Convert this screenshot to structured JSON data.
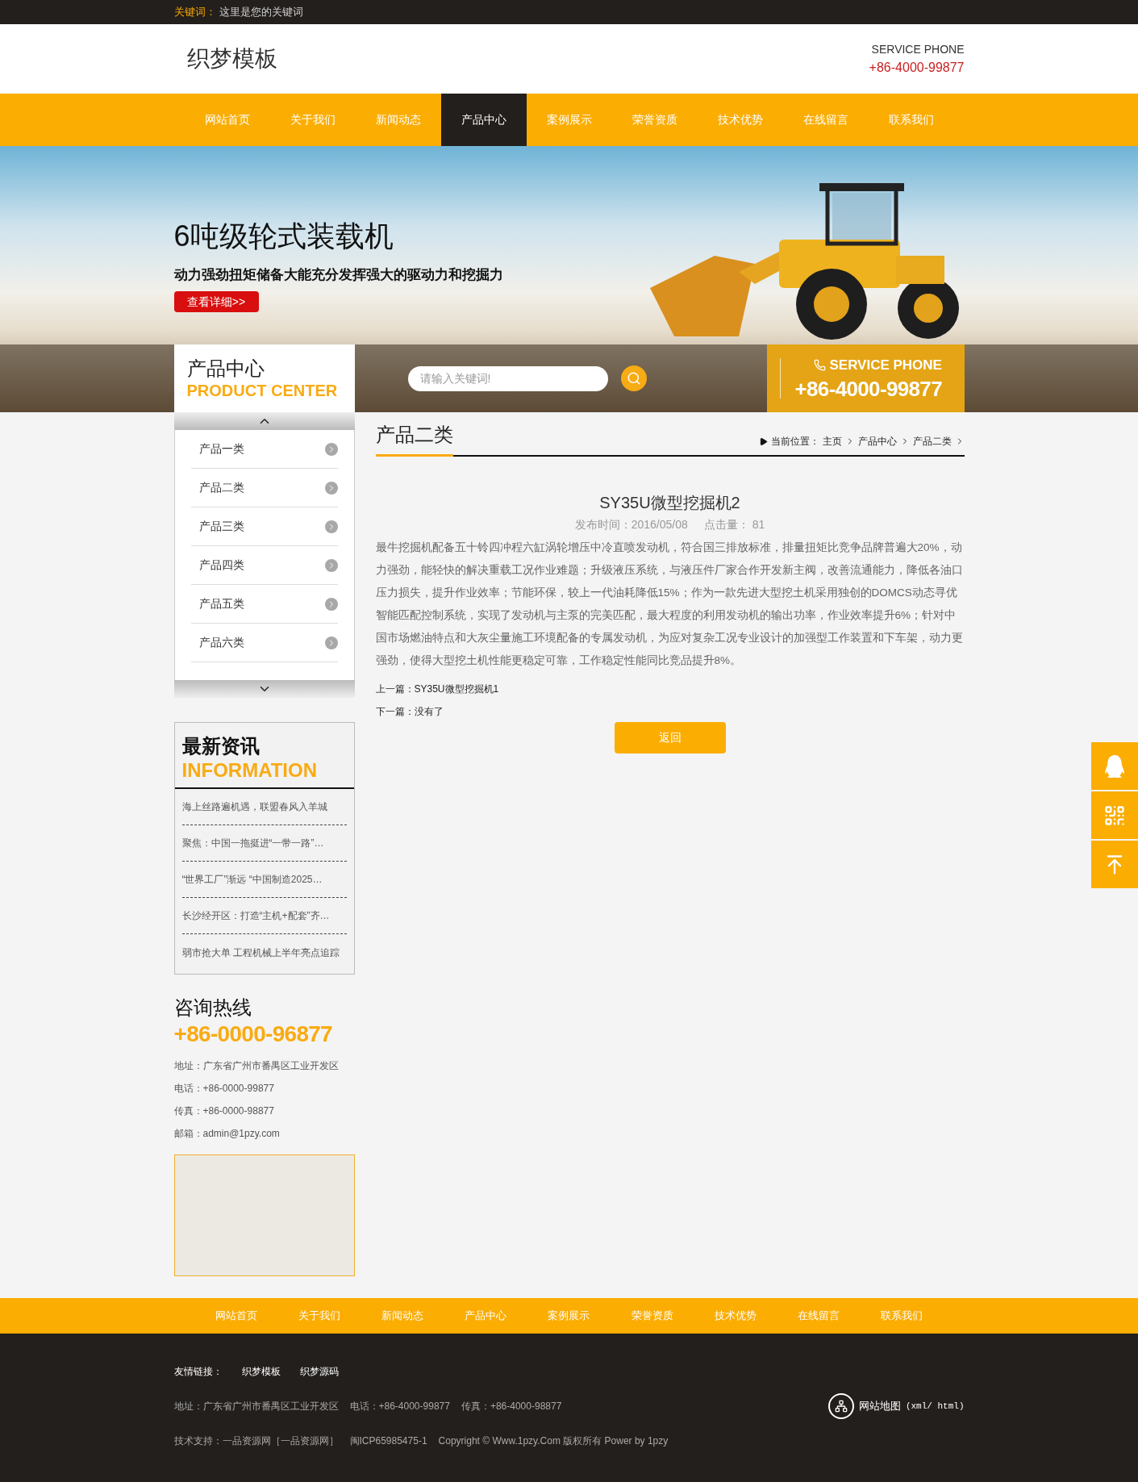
{
  "top_bar": {
    "label": "关键词：",
    "text": "这里是您的关键词"
  },
  "header": {
    "logo": "织梦模板",
    "service_label": "SERVICE PHONE",
    "service_phone": "+86-4000-99877"
  },
  "nav": [
    {
      "label": "网站首页",
      "selected": false
    },
    {
      "label": "关于我们",
      "selected": false
    },
    {
      "label": "新闻动态",
      "selected": false
    },
    {
      "label": "产品中心",
      "selected": true
    },
    {
      "label": "案例展示",
      "selected": false
    },
    {
      "label": "荣誉资质",
      "selected": false
    },
    {
      "label": "技术优势",
      "selected": false
    },
    {
      "label": "在线留言",
      "selected": false
    },
    {
      "label": "联系我们",
      "selected": false
    }
  ],
  "banner": {
    "title": "6吨级轮式装载机",
    "subtitle": "动力强劲扭矩储备大能充分发挥强大的驱动力和挖掘力",
    "button": "查看详细>>"
  },
  "product_center": {
    "title": "产品中心",
    "subtitle": "PRODUCT CENTER"
  },
  "search": {
    "placeholder": "请输入关键词!"
  },
  "service_box": {
    "label": "SERVICE PHONE",
    "phone": "+86-4000-99877"
  },
  "sidebar": {
    "categories": [
      "产品一类",
      "产品二类",
      "产品三类",
      "产品四类",
      "产品五类",
      "产品六类"
    ],
    "news": {
      "title": "最新资讯",
      "subtitle": "INFORMATION",
      "items": [
        "海上丝路遍机遇，联盟春风入羊城",
        "聚焦：中国一拖挺进“一带一路”…",
        "“世界工厂”渐远 “中国制造2025…",
        "长沙经开区：打造“主机+配套”齐…",
        "弱市抢大单 工程机械上半年亮点追踪"
      ]
    },
    "contact": {
      "title": "咨询热线",
      "phone": "+86-0000-96877",
      "lines": [
        "地址：广东省广州市番禺区工业开发区",
        "电话：+86-0000-99877",
        "传真：+86-0000-98877",
        "邮箱：admin@1pzy.com"
      ]
    }
  },
  "content": {
    "heading": "产品二类",
    "breadcrumb": {
      "label": "当前位置：",
      "items": [
        "主页",
        "产品中心",
        "产品二类"
      ]
    },
    "article": {
      "title": "SY35U微型挖掘机2",
      "meta": [
        "发布时间：2016/05/08",
        "点击量： 81"
      ],
      "body": "最牛挖掘机配备五十铃四冲程六缸涡轮增压中冷直喷发动机，符合国三排放标准，排量扭矩比竞争品牌普遍大20%，动力强劲，能轻快的解决重载工况作业难题；升级液压系统，与液压件厂家合作开发新主阀，改善流通能力，降低各油口压力损失，提升作业效率；节能环保，较上一代油耗降低15%；作为一款先进大型挖土机采用独创的DOMCS动态寻优智能匹配控制系统，实现了发动机与主泵的完美匹配，最大程度的利用发动机的输出功率，作业效率提升6%；针对中国市场燃油特点和大灰尘量施工环境配备的专属发动机，为应对复杂工况专业设计的加强型工作装置和下车架，动力更强劲，使得大型挖土机性能更稳定可靠，工作稳定性能同比竞品提升8%。",
      "prev": "上一篇：SY35U微型挖掘机1",
      "next": "下一篇：没有了",
      "back_button": "返回"
    }
  },
  "footer_nav": [
    "网站首页",
    "关于我们",
    "新闻动态",
    "产品中心",
    "案例展示",
    "荣誉资质",
    "技术优势",
    "在线留言",
    "联系我们"
  ],
  "footer": {
    "links_label": "友情链接：",
    "links": [
      "织梦模板",
      "织梦源码"
    ],
    "info": [
      "地址：广东省广州市番禺区工业开发区",
      "电话：+86-4000-99877",
      "传真：+86-4000-98877"
    ],
    "support": [
      "技术支持：一品资源网［一品资源网］",
      "闽ICP65985475-1",
      "Copyright © Www.1pzy.Com 版权所有 Power by 1pzy"
    ],
    "sitemap": "网站地图",
    "sitemap_formats": "(xml/ html)"
  }
}
